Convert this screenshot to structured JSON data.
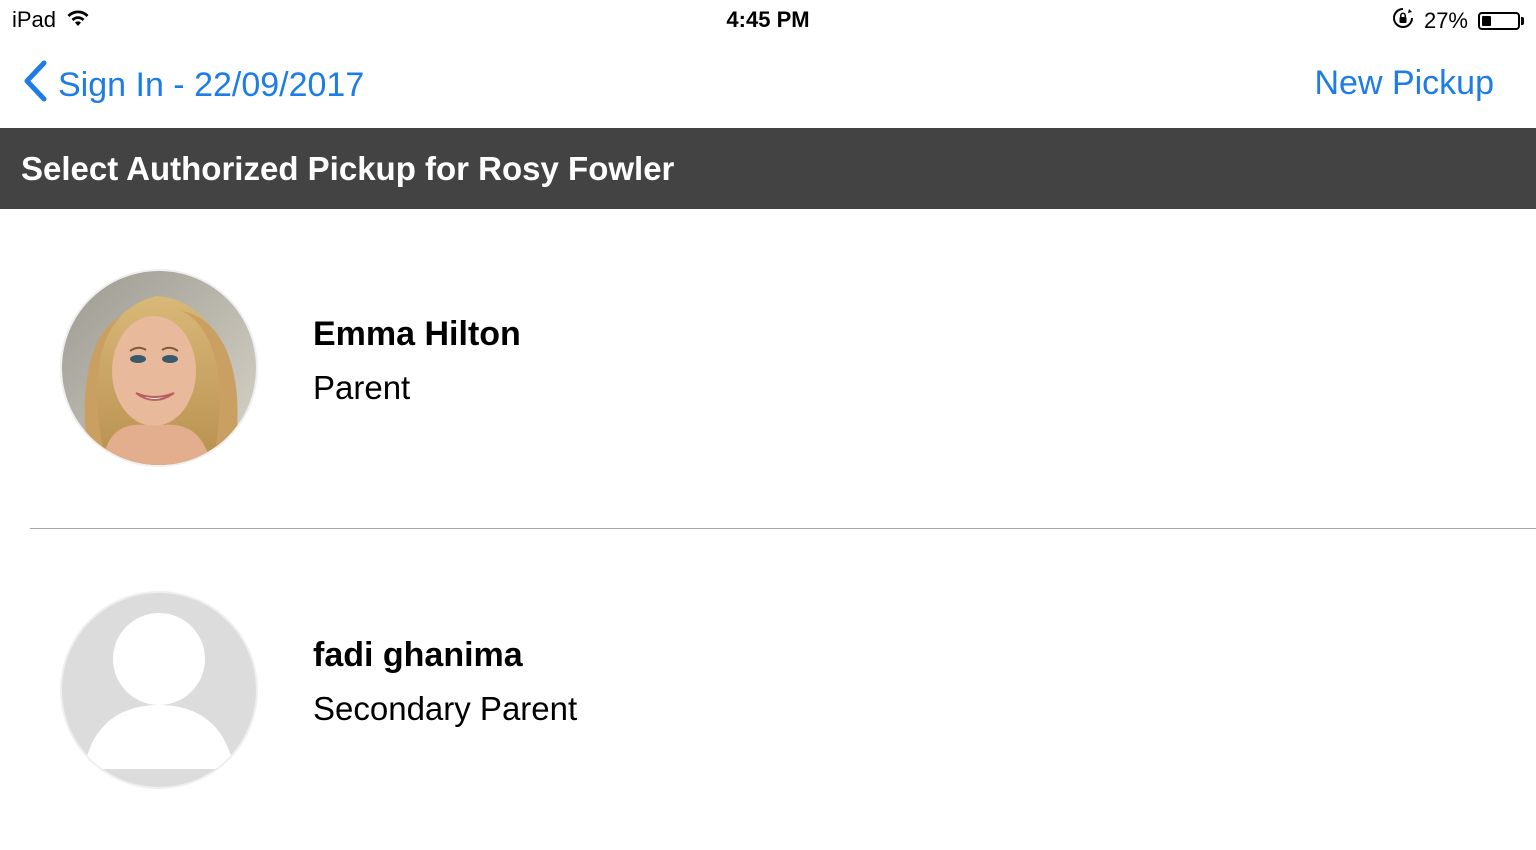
{
  "status_bar": {
    "device": "iPad",
    "time": "4:45 PM",
    "battery": "27%",
    "battery_level": 0.27
  },
  "nav": {
    "back_label": "Sign In - 22/09/2017",
    "new_pickup_label": "New Pickup"
  },
  "header": {
    "title": "Select Authorized Pickup for Rosy Fowler"
  },
  "pickups": [
    {
      "name": "Emma Hilton",
      "role": "Parent",
      "avatar": "photo"
    },
    {
      "name": "fadi ghanima",
      "role": "Secondary Parent",
      "avatar": "default-person-icon"
    }
  ],
  "colors": {
    "accent": "#1e7ce6",
    "header_bg": "#444344"
  }
}
